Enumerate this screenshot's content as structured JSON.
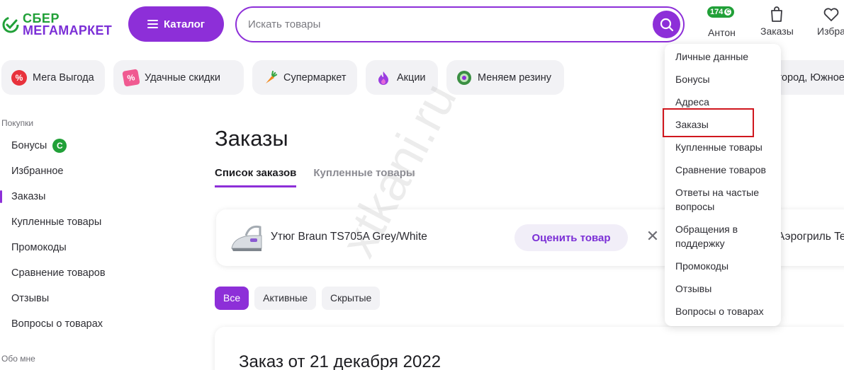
{
  "brand": {
    "line1": "СБЕР",
    "line2": "МЕГАМАРКЕТ",
    "green": "#21a038",
    "purple": "#8d2fd8"
  },
  "header": {
    "catalog_label": "Каталог",
    "search_placeholder": "Искать товары",
    "points_badge": "174",
    "user_label": "Антон",
    "orders_label": "Заказы",
    "favorites_label": "Избра"
  },
  "chips": [
    {
      "label": "Мега Выгода",
      "icon": "percent-red-icon"
    },
    {
      "label": "Удачные скидки",
      "icon": "percent-tag-icon"
    },
    {
      "label": "Супермаркет",
      "icon": "carrot-icon"
    },
    {
      "label": "Акции",
      "icon": "flame-icon"
    },
    {
      "label": "Меняем резину",
      "icon": "tire-icon"
    }
  ],
  "chip_right": "город, Южное",
  "sidebar": {
    "heading": "Покупки",
    "items": [
      {
        "label": "Бонусы"
      },
      {
        "label": "Избранное"
      },
      {
        "label": "Заказы"
      },
      {
        "label": "Купленные товары"
      },
      {
        "label": "Промокоды"
      },
      {
        "label": "Сравнение товаров"
      },
      {
        "label": "Отзывы"
      },
      {
        "label": "Вопросы о товарах"
      }
    ],
    "heading2": "Обо мне"
  },
  "main": {
    "title": "Заказы",
    "tabs": [
      {
        "label": "Список заказов"
      },
      {
        "label": "Купленные товары"
      }
    ],
    "rate_card": {
      "product": "Утюг Braun TS705A Grey/White",
      "rate_button": "Оценить товар",
      "next_product": "Аэрогриль Tefal"
    },
    "filters": [
      {
        "label": "Все"
      },
      {
        "label": "Активные"
      },
      {
        "label": "Скрытые"
      }
    ],
    "order_title": "Заказ от 21 декабря 2022"
  },
  "dropdown": {
    "items": [
      "Личные данные",
      "Бонусы",
      "Адреса",
      "Заказы",
      "Купленные товары",
      "Сравнение товаров",
      "Ответы на частые вопросы",
      "Обращения в поддержку",
      "Промокоды",
      "Отзывы",
      "Вопросы о товарах"
    ]
  },
  "watermark": "xtkani.ru"
}
